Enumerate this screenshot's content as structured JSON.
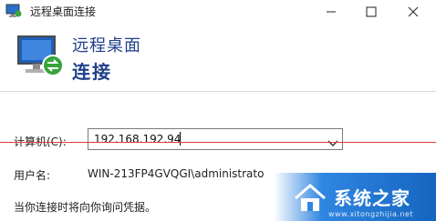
{
  "window": {
    "title": "远程桌面连接",
    "controls": {
      "minimize": "minimize-icon",
      "maximize": "maximize-icon",
      "close": "close-icon"
    }
  },
  "header": {
    "line1": "远程桌面",
    "line2": "连接",
    "title_color": "#1f3f8a"
  },
  "form": {
    "computer_label": "计算机(C):",
    "computer_value": "192.168.192.94",
    "user_label": "用户名:",
    "user_value": "WIN-213FP4GVQGI\\administrato",
    "note": "当你连接时将向你询问凭据。"
  },
  "watermark": {
    "text": "系统之家",
    "sub": "www.xitongzhijia.net",
    "color": "#2f86e0"
  },
  "annotation": {
    "line_color": "#e23b3b"
  }
}
